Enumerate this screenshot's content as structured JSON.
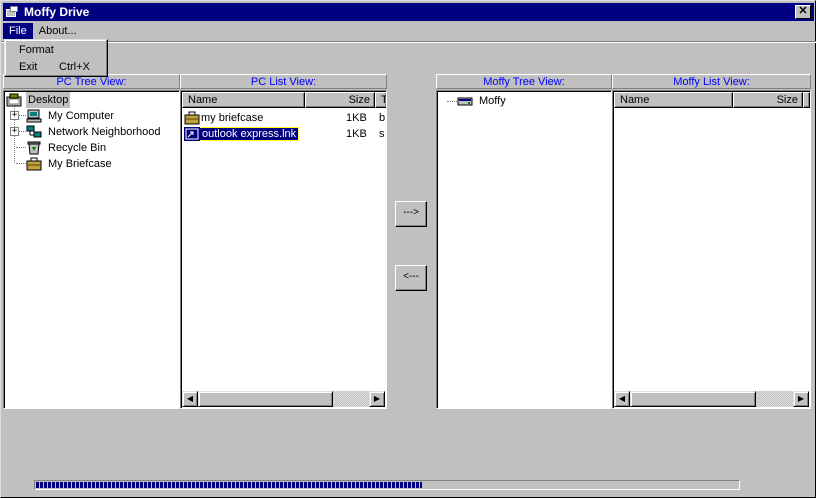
{
  "window": {
    "title": "Moffy Drive",
    "close_glyph": "✕"
  },
  "menu": {
    "file": "File",
    "about": "About...",
    "file_items": [
      {
        "label": "Format",
        "shortcut": ""
      },
      {
        "label": "Exit",
        "shortcut": "Ctrl+X"
      }
    ]
  },
  "pc_tree": {
    "header": "PC Tree View:",
    "items": [
      {
        "label": "Desktop",
        "icon": "desktop-icon",
        "selected": true
      },
      {
        "label": "My Computer",
        "icon": "computer-icon",
        "expander": "+"
      },
      {
        "label": "Network Neighborhood",
        "icon": "network-icon",
        "expander": "+"
      },
      {
        "label": "Recycle Bin",
        "icon": "recycle-bin-icon"
      },
      {
        "label": "My Briefcase",
        "icon": "briefcase-icon"
      }
    ]
  },
  "pc_list": {
    "header": "PC List View:",
    "columns": [
      "Name",
      "Size",
      "T"
    ],
    "rows": [
      {
        "name": "my briefcase",
        "size": "1KB",
        "type": "b",
        "icon": "briefcase-icon",
        "selected": false
      },
      {
        "name": "outlook express.lnk",
        "size": "1KB",
        "type": "s",
        "icon": "shortcut-icon",
        "selected": true
      }
    ]
  },
  "transfer": {
    "to_moffy": "--->",
    "to_pc": "<---"
  },
  "moffy_tree": {
    "header": "Moffy Tree View:",
    "items": [
      {
        "label": "Moffy",
        "icon": "drive-icon"
      }
    ]
  },
  "moffy_list": {
    "header": "Moffy List View:",
    "columns": [
      "Name",
      "Size"
    ]
  },
  "progress": {
    "fraction": 0.55
  },
  "colors": {
    "title_bg": "#000080",
    "header_text": "#0000ff",
    "face": "#c0c0c0"
  }
}
